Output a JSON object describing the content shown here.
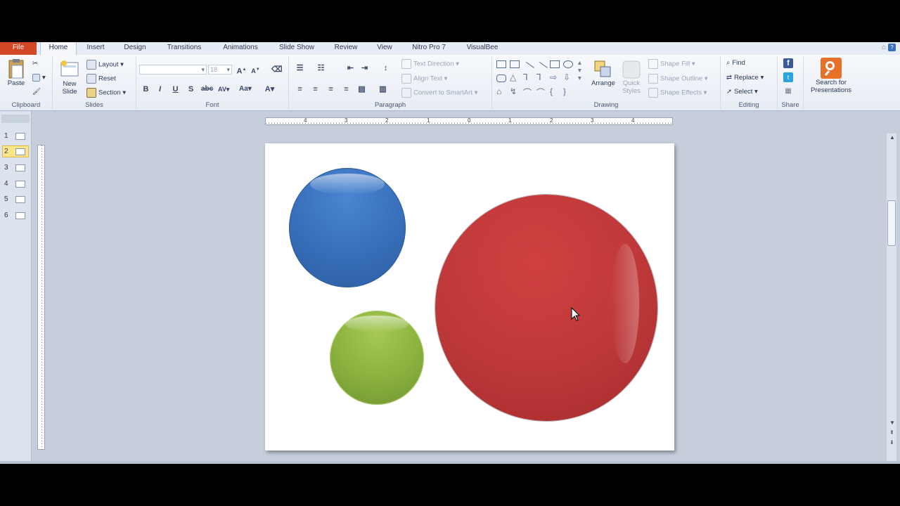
{
  "tabs": [
    "File",
    "Home",
    "Insert",
    "Design",
    "Transitions",
    "Animations",
    "Slide Show",
    "Review",
    "View",
    "Nitro Pro 7",
    "VisualBee"
  ],
  "ribbon": {
    "clipboard": {
      "paste": "Paste",
      "label": "Clipboard"
    },
    "slides": {
      "new_slide_1": "New",
      "new_slide_2": "Slide",
      "layout": "Layout",
      "reset": "Reset",
      "section": "Section",
      "label": "Slides"
    },
    "font": {
      "size": "18",
      "label": "Font"
    },
    "paragraph": {
      "text_direction": "Text Direction",
      "align_text": "Align Text",
      "convert_smartart": "Convert to SmartArt",
      "label": "Paragraph"
    },
    "drawing": {
      "arrange": "Arrange",
      "quick_styles_1": "Quick",
      "quick_styles_2": "Styles",
      "shape_fill": "Shape Fill",
      "shape_outline": "Shape Outline",
      "shape_effects": "Shape Effects",
      "label": "Drawing"
    },
    "editing": {
      "find": "Find",
      "replace": "Replace",
      "select": "Select",
      "label": "Editing"
    },
    "share": {
      "label": "Share"
    },
    "search": {
      "line1": "Search for",
      "line2": "Presentations"
    }
  },
  "thumbnails": [
    "1",
    "2",
    "3",
    "4",
    "5",
    "6"
  ],
  "selected_slide": "2",
  "ruler_h": [
    "4",
    "3",
    "2",
    "1",
    "0",
    "1",
    "2",
    "3",
    "4"
  ],
  "colors": {
    "blue": "#3a72bf",
    "green": "#8cb33f",
    "red": "#c0393a",
    "file_tab": "#d24726"
  }
}
